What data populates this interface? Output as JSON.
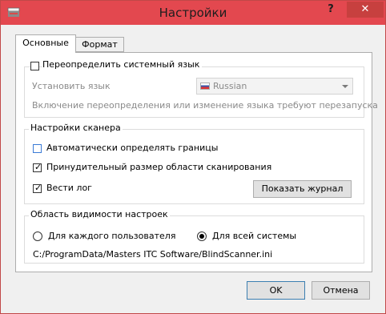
{
  "window": {
    "title": "Настройки",
    "help_label": "?",
    "close_label": "✕",
    "accent_color": "#e3484f"
  },
  "tabs": [
    {
      "label": "Основные",
      "active": true
    },
    {
      "label": "Формат",
      "active": false
    }
  ],
  "language_group": {
    "override_label": "Переопределить системный язык",
    "override_checked": false,
    "set_language_label": "Установить язык",
    "language_value": "Russian",
    "restart_note": "Включение переопределения или изменение языка требуют перезапуска"
  },
  "scanner_group": {
    "title": "Настройки сканера",
    "auto_borders_label": "Автоматически определять границы",
    "auto_borders_checked": false,
    "forced_size_label": "Принудительный размер области сканирования",
    "forced_size_checked": true,
    "log_label": "Вести лог",
    "log_checked": true,
    "show_log_button": "Показать журнал"
  },
  "scope_group": {
    "title": "Область видимости настроек",
    "per_user_label": "Для каждого пользователя",
    "per_user_selected": false,
    "all_system_label": "Для всей системы",
    "all_system_selected": true,
    "ini_path": "C:/ProgramData/Masters ITC Software/BlindScanner.ini"
  },
  "footer": {
    "ok_label": "OK",
    "cancel_label": "Отмена"
  }
}
